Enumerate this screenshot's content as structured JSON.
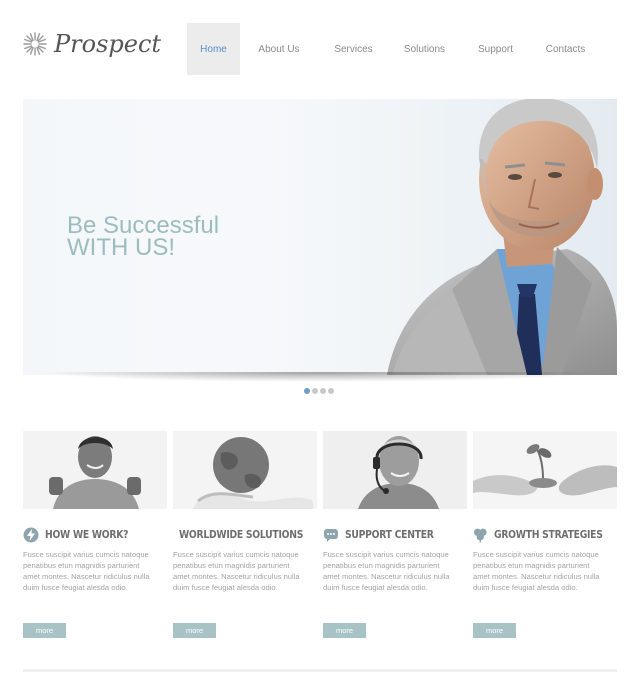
{
  "brand": {
    "name": "Prospect",
    "icon": "sunburst-logo-icon"
  },
  "nav": {
    "items": [
      {
        "label": "Home",
        "active": true
      },
      {
        "label": "About Us",
        "active": false
      },
      {
        "label": "Services",
        "active": false
      },
      {
        "label": "Solutions",
        "active": false
      },
      {
        "label": "Support",
        "active": false
      },
      {
        "label": "Contacts",
        "active": false
      }
    ]
  },
  "hero": {
    "title_line1": "Be Successful",
    "title_line2": "WITH US!",
    "slides": 4,
    "active_slide": 1
  },
  "features": [
    {
      "title": "HOW WE WORK?",
      "icon": "lightning-icon",
      "text": "Fusce suscipit varius cumcis natoque penatibus etun magnidis parturient amet montes. Nascetur ridiculus nulla duim fusce feugiat alesda odio.",
      "button": "more"
    },
    {
      "title": "WORLDWIDE SOLUTIONS",
      "icon": "globe-icon",
      "text": "Fusce suscipit varius cumcis natoque penatibus etun magnidis parturient amet montes. Nascetur ridiculus nulla duim fusce feugiat alesda odio.",
      "button": "more"
    },
    {
      "title": "SUPPORT CENTER",
      "icon": "chat-bubble-icon",
      "text": "Fusce suscipit varius cumcis natoque penatibus etun magnidis parturient amet montes. Nascetur ridiculus nulla duim fusce feugiat alesda odio.",
      "button": "more"
    },
    {
      "title": "GROWTH STRATEGIES",
      "icon": "leaf-icon",
      "text": "Fusce suscipit varius cumcis natoque penatibus etun magnidis parturient amet montes. Nascetur ridiculus nulla duim fusce feugiat alesda odio.",
      "button": "more"
    }
  ],
  "colors": {
    "accent_blue": "#5d8ec7",
    "hero_title": "#9dbcc0",
    "button": "#a7c3c6",
    "nav_active_bg": "#ececec"
  }
}
